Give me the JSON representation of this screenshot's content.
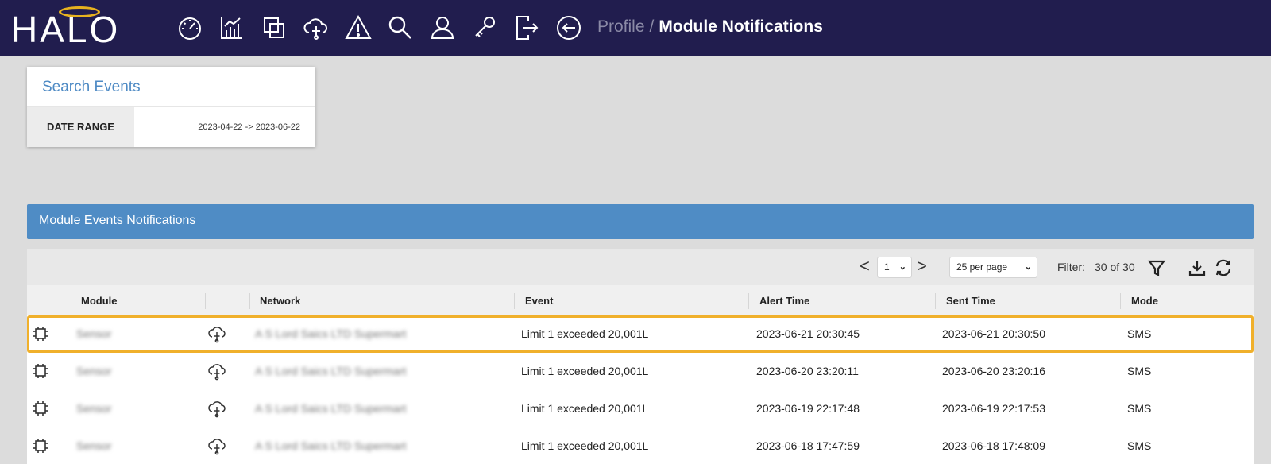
{
  "app": {
    "logo": "HALO",
    "colors": {
      "nav_bg": "#211d4e",
      "halo_ring": "#e7b21f",
      "accent_blue": "#4f8cc5",
      "selected_outline": "#f0b02b"
    }
  },
  "nav": {
    "icons": [
      "dashboard-gauge-icon",
      "chart-icon",
      "copy-icon",
      "cloud-network-icon",
      "warning-icon",
      "search-icon",
      "user-icon",
      "key-icon",
      "logout-icon",
      "back-arrow-icon"
    ],
    "breadcrumb": {
      "parent": "Profile",
      "separator": "/",
      "current": "Module Notifications"
    }
  },
  "search": {
    "title": "Search Events",
    "date_range_label": "DATE RANGE",
    "date_range_value": "2023-04-22 -> 2023-06-22"
  },
  "panel": {
    "title": "Module Events Notifications",
    "pager": {
      "prev": "<",
      "page": "1",
      "next": ">"
    },
    "per_page": "25 per page",
    "filter_label": "Filter:",
    "filter_count": "30 of 30",
    "toolbar_icons": [
      "filter-icon",
      "download-icon",
      "refresh-icon"
    ]
  },
  "table": {
    "columns": [
      "Module",
      "Network",
      "Event",
      "Alert Time",
      "Sent Time",
      "Mode"
    ],
    "rows": [
      {
        "module": "Sensor",
        "network": "A S Lord Saics LTD Supermart",
        "event": "Limit 1 exceeded 20,001L",
        "alert_time": "2023-06-21 20:30:45",
        "sent_time": "2023-06-21 20:30:50",
        "mode": "SMS"
      },
      {
        "module": "Sensor",
        "network": "A S Lord Saics LTD Supermart",
        "event": "Limit 1 exceeded 20,001L",
        "alert_time": "2023-06-20 23:20:11",
        "sent_time": "2023-06-20 23:20:16",
        "mode": "SMS"
      },
      {
        "module": "Sensor",
        "network": "A S Lord Saics LTD Supermart",
        "event": "Limit 1 exceeded 20,001L",
        "alert_time": "2023-06-19 22:17:48",
        "sent_time": "2023-06-19 22:17:53",
        "mode": "SMS"
      },
      {
        "module": "Sensor",
        "network": "A S Lord Saics LTD Supermart",
        "event": "Limit 1 exceeded 20,001L",
        "alert_time": "2023-06-18 17:47:59",
        "sent_time": "2023-06-18 17:48:09",
        "mode": "SMS"
      }
    ]
  }
}
